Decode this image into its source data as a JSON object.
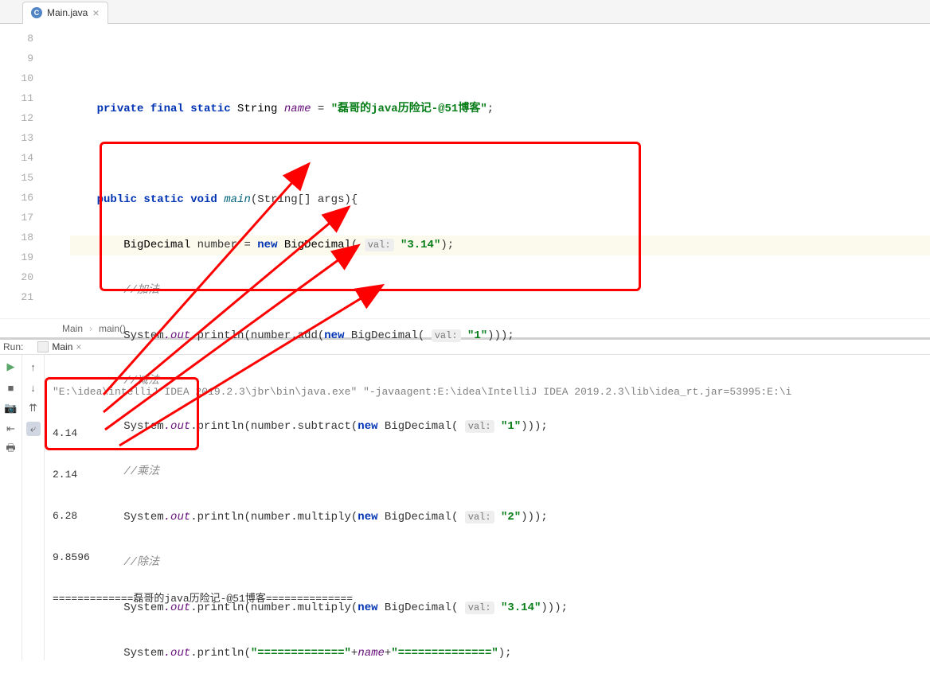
{
  "tab": {
    "file_name": "Main.java",
    "icon_letter": "C"
  },
  "gutter_lines": [
    "8",
    "9",
    "10",
    "11",
    "12",
    "13",
    "14",
    "15",
    "16",
    "17",
    "18",
    "19",
    "20",
    "21"
  ],
  "code": {
    "l9": {
      "k1": "private final static",
      "type": "String",
      "var": "name",
      "eq": " = ",
      "str": "\"磊哥的java历险记-@51博客\"",
      "end": ";"
    },
    "l11": {
      "k1": "public static void",
      "m": "main",
      "sig": "(String[] args){"
    },
    "l12": {
      "type": "BigDecimal",
      "var": "number",
      "eq": " = ",
      "k2": "new",
      "type2": "BigDecimal",
      "hint": "val:",
      "str": "\"3.14\"",
      "end": ");"
    },
    "l13": {
      "cmt": "//加法"
    },
    "l14": {
      "sys": "System",
      "out": ".out",
      "p": ".println(number.add(",
      "k": "new",
      "t": "BigDecimal",
      "hint": "val:",
      "str": "\"1\"",
      "end": ")));"
    },
    "l15": {
      "cmt": "//减法"
    },
    "l16": {
      "sys": "System",
      "out": ".out",
      "p": ".println(number.subtract(",
      "k": "new",
      "t": "BigDecimal",
      "hint": "val:",
      "str": "\"1\"",
      "end": ")));"
    },
    "l17": {
      "cmt": "//乘法"
    },
    "l18": {
      "sys": "System",
      "out": ".out",
      "p": ".println(number.multiply(",
      "k": "new",
      "t": "BigDecimal",
      "hint": "val:",
      "str": "\"2\"",
      "end": ")));"
    },
    "l19": {
      "cmt": "//除法"
    },
    "l20": {
      "sys": "System",
      "out": ".out",
      "p": ".println(number.multiply(",
      "k": "new",
      "t": "BigDecimal",
      "hint": "val:",
      "str": "\"3.14\"",
      "end": ")));"
    },
    "l21": {
      "sys": "System",
      "out": ".out",
      "p": ".println(",
      "s1": "\"=============\"",
      "plus": "+",
      "nm": "name",
      "plus2": "+",
      "s2": "\"==============\"",
      "end": ");"
    }
  },
  "breadcrumb": {
    "class": "Main",
    "method": "main()"
  },
  "run": {
    "label": "Run:",
    "tab_name": "Main",
    "cmd": "\"E:\\idea\\intelliJ IDEA 2019.2.3\\jbr\\bin\\java.exe\" \"-javaagent:E:\\idea\\IntelliJ IDEA 2019.2.3\\lib\\idea_rt.jar=53995:E:\\i",
    "out1": "4.14",
    "out2": "2.14",
    "out3": "6.28",
    "out4": "9.8596",
    "out5": "=============磊哥的java历险记-@51博客=============="
  }
}
